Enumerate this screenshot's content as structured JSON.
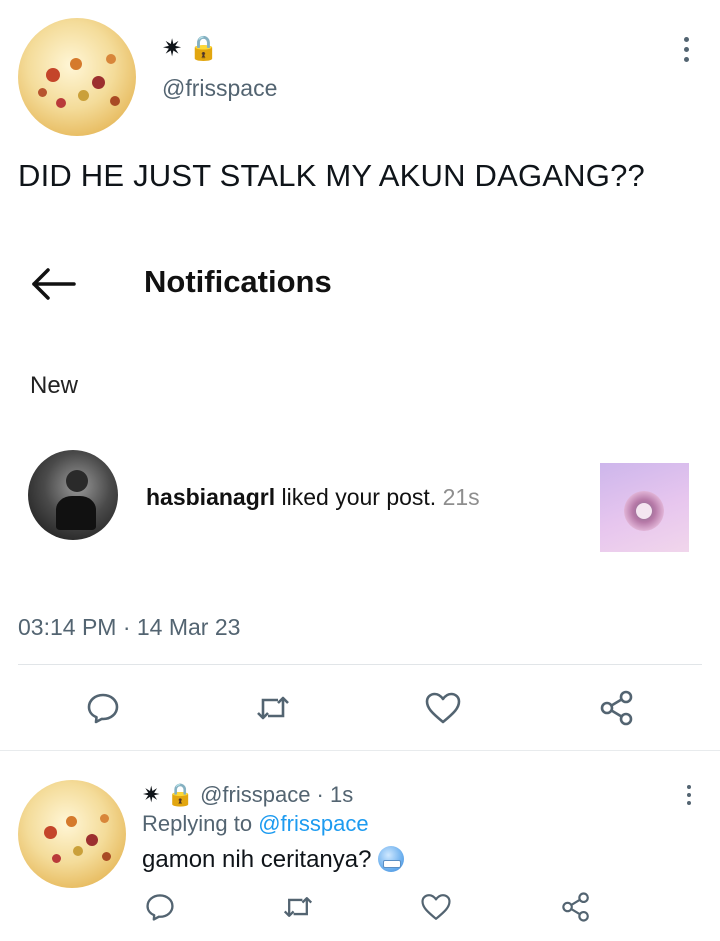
{
  "tweet": {
    "name_glyphs": "✷ 🔒",
    "handle": "@frisspace",
    "text": "DID HE JUST STALK MY AKUN DAGANG??",
    "timestamp": "03:14 PM · 14 Mar 23"
  },
  "screenshot": {
    "header_title": "Notifications",
    "section_label": "New",
    "notification": {
      "username": "hasbianagrl",
      "action": " liked your post.",
      "time": " 21s"
    }
  },
  "reply": {
    "name_glyphs": "✷ 🔒",
    "handle_time": "@frisspace · 1s",
    "replying_prefix": "Replying to ",
    "replying_handle": "@frisspace",
    "text": "gamon nih ceritanya?",
    "emoji": "🥶"
  },
  "icons": {
    "reply": "comment-icon",
    "retweet": "retweet-icon",
    "like": "heart-icon",
    "share": "share-icon",
    "more": "more-vertical-icon",
    "back": "arrow-left-icon"
  },
  "colors": {
    "text": "#0f1419",
    "muted": "#536471",
    "link": "#1d9bf0",
    "divider": "#e1e5e8"
  }
}
